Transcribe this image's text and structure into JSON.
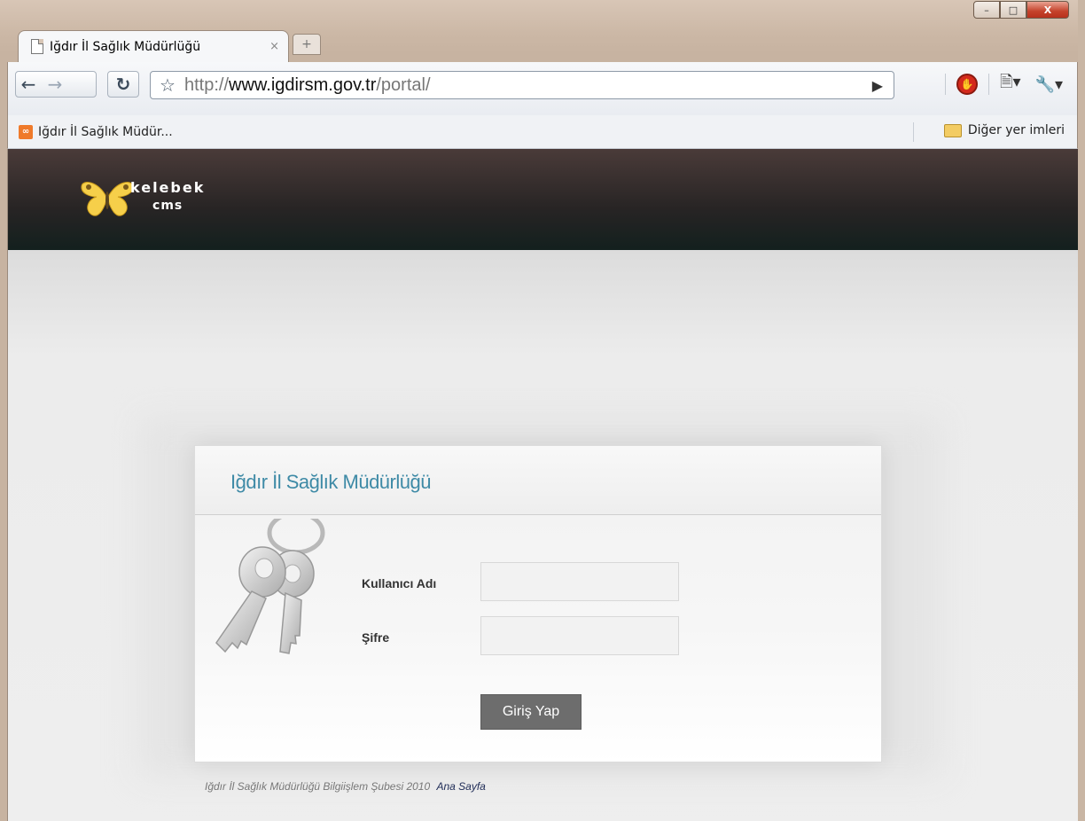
{
  "window": {
    "tab_title": "Iğdır İl Sağlık Müdürlüğü",
    "tab_close": "×",
    "new_tab": "+",
    "min": "–",
    "max": "□",
    "close": "X"
  },
  "toolbar": {
    "url_scheme": "http://",
    "url_host": "www.igdirsm.gov.tr",
    "url_path": "/portal/"
  },
  "bookmarks": {
    "items": [
      {
        "label": "Iğdır İl Sağlık Müdür..."
      }
    ],
    "other": "Diğer yer imleri"
  },
  "header": {
    "logo_line1": "kelebek",
    "logo_line2": "cms"
  },
  "login": {
    "title": "Iğdır İl Sağlık Müdürlüğü",
    "username_label": "Kullanıcı Adı",
    "username_value": "",
    "password_label": "Şifre",
    "password_value": "",
    "submit_label": "Giriş Yap"
  },
  "footer": {
    "text": "Iğdır İl Sağlık Müdürlüğü Bilgiişlem Şubesi 2010",
    "link": "Ana Sayfa"
  },
  "colors": {
    "title_accent": "#3e8aa6",
    "button_bg": "#6d6d6d",
    "header_bg": "#2a2525"
  }
}
